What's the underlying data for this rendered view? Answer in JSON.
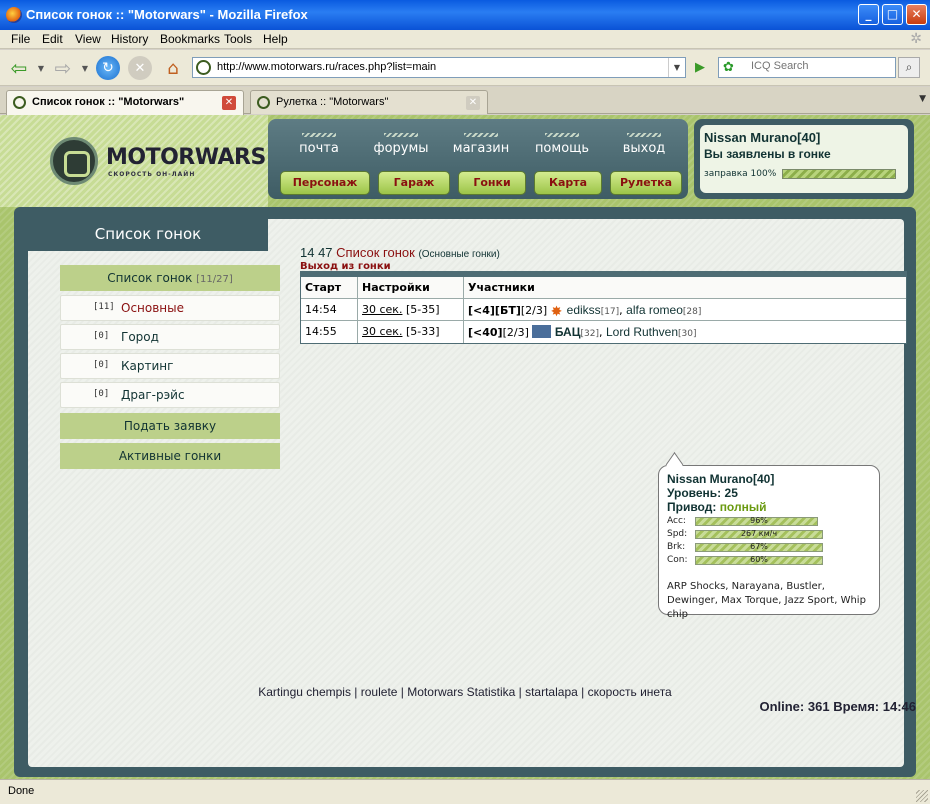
{
  "window": {
    "title": "Список гонок :: \"Motorwars\" - Mozilla Firefox",
    "buttons": [
      "_",
      "□",
      "✕"
    ]
  },
  "menu": [
    "File",
    "Edit",
    "View",
    "History",
    "Bookmarks",
    "Tools",
    "Help"
  ],
  "nav": {
    "url": "http://www.motorwars.ru/races.php?list=main",
    "search_placeholder": "ICQ Search"
  },
  "tabs": [
    {
      "label": "Список гонок :: \"Motorwars\"",
      "active": true
    },
    {
      "label": "Рулетка :: \"Motorwars\"",
      "active": false
    }
  ],
  "site": {
    "logo": "MOTORWARS.RU",
    "logo_sub": "СКОРОСТЬ ОН-ЛАЙН",
    "top_links": [
      "почта",
      "форумы",
      "магазин",
      "помощь",
      "выход"
    ],
    "buttons": [
      "Персонаж",
      "Гараж",
      "Гонки",
      "Карта",
      "Рулетка"
    ],
    "status": {
      "car": "Nissan Murano[40]",
      "race": "Вы заявлены в гонке",
      "fuel_label": "заправка 100%",
      "fuel": 1.0
    }
  },
  "sidebar": {
    "header": "Список гонок",
    "list_title": "Список гонок",
    "list_count": "[11/27]",
    "items": [
      {
        "count": "[11]",
        "label": "Основные",
        "selected": true
      },
      {
        "count": "[0]",
        "label": "Город",
        "selected": false
      },
      {
        "count": "[0]",
        "label": "Картинг",
        "selected": false
      },
      {
        "count": "[0]",
        "label": "Драг-рэйс",
        "selected": false
      }
    ],
    "apply": "Подать заявку",
    "active": "Активные гонки"
  },
  "races": {
    "time": "14 47",
    "title": "Список гонок",
    "subtitle": "(Основные гонки)",
    "leave": "Выход из гонки",
    "columns": [
      "Старт",
      "Настройки",
      "Участники"
    ],
    "rows": [
      {
        "start": "14:54",
        "setting_link": "30 сек.",
        "setting_range": "[5-35]",
        "prefix": "[<4][БТ]",
        "slots": "[2/3]",
        "participants": [
          {
            "name": "edikss",
            "level": "[17]",
            "icon": "burst-icon"
          },
          {
            "name": "alfa romeo",
            "level": "[28]"
          }
        ]
      },
      {
        "start": "14:55",
        "setting_link": "30 сек.",
        "setting_range": "[5-33]",
        "prefix": "[<40]",
        "slots": "[2/3]",
        "participants": [
          {
            "name": "БАЦ",
            "level": "[32]",
            "icon": "flag-icon"
          },
          {
            "name": "Lord Ruthven",
            "level": "[30]"
          }
        ]
      }
    ]
  },
  "tooltip": {
    "car": "Nissan Murano[40]",
    "level_label": "Уровень:",
    "level": "25",
    "drive_label": "Привод:",
    "drive": "полный",
    "stats": [
      {
        "key": "Acc:",
        "value": "96%",
        "level": 0.96
      },
      {
        "key": "Spd:",
        "value": "267 км/ч",
        "level": 1.0
      },
      {
        "key": "Brk:",
        "value": "67%",
        "level": 1.0
      },
      {
        "key": "Con:",
        "value": "60%",
        "level": 1.0
      }
    ],
    "parts": "ARP Shocks, Narayana, Bustler, Dewinger, Max Torque, Jazz Sport, Whip chip"
  },
  "footer": {
    "links": [
      "Kartingu chempis",
      "roulete",
      "Motorwars Statistika",
      "startalapa",
      "скорость инета"
    ],
    "online_label": "Online:",
    "online": "361",
    "time_label": "Время:",
    "time": "14:46"
  },
  "statusbar": "Done"
}
